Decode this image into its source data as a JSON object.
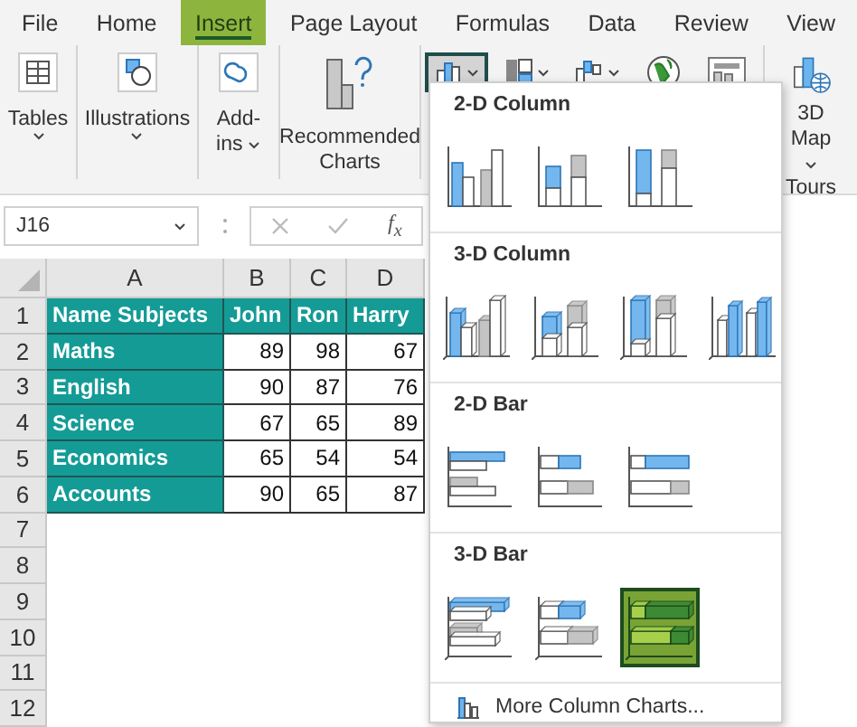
{
  "tabs": [
    {
      "label": "File",
      "selected": false
    },
    {
      "label": "Home",
      "selected": false
    },
    {
      "label": "Insert",
      "selected": true
    },
    {
      "label": "Page Layout",
      "selected": false
    },
    {
      "label": "Formulas",
      "selected": false
    },
    {
      "label": "Data",
      "selected": false
    },
    {
      "label": "Review",
      "selected": false
    },
    {
      "label": "View",
      "selected": false
    }
  ],
  "ribbon": {
    "groups": [
      {
        "kind": "tables",
        "label": "Tables",
        "dropdown": true
      },
      {
        "kind": "illustrations",
        "label": "Illustrations",
        "dropdown": true
      },
      {
        "kind": "addins",
        "label": "Add-ins",
        "dropdown": true
      },
      {
        "kind": "recommended",
        "label": "Recommended Charts",
        "dropdown": false
      },
      {
        "kind": "charts"
      },
      {
        "kind": "tours",
        "label": "3D Map",
        "dropdown": true,
        "group_label": "Tours"
      }
    ],
    "chart_buttons": [
      {
        "kind": "column",
        "selected": true,
        "dropdown": true
      },
      {
        "kind": "hierarchy",
        "selected": false,
        "dropdown": true
      },
      {
        "kind": "line",
        "selected": false,
        "dropdown": true
      },
      {
        "kind": "map",
        "selected": false,
        "dropdown": false
      },
      {
        "kind": "pivot",
        "selected": false,
        "dropdown": false
      }
    ]
  },
  "formula_bar": {
    "name_box": "J16",
    "function_label": "f$_{x}$"
  },
  "sheet": {
    "columns": [
      "A",
      "B",
      "C",
      "D"
    ],
    "rows": [
      {
        "number": "1",
        "cells": [
          {
            "text": "Name Subjects",
            "highlighted": true
          },
          {
            "text": "John",
            "highlighted": true
          },
          {
            "text": "Ron",
            "highlighted": true
          },
          {
            "text": "Harry",
            "highlighted": true
          }
        ]
      },
      {
        "number": "2",
        "cells": [
          {
            "text": "Maths",
            "highlighted": true
          },
          {
            "text": "89",
            "highlighted": false
          },
          {
            "text": "98",
            "highlighted": false
          },
          {
            "text": "67",
            "highlighted": false
          }
        ]
      },
      {
        "number": "3",
        "cells": [
          {
            "text": "English",
            "highlighted": true
          },
          {
            "text": "90",
            "highlighted": false
          },
          {
            "text": "87",
            "highlighted": false
          },
          {
            "text": "76",
            "highlighted": false
          }
        ]
      },
      {
        "number": "4",
        "cells": [
          {
            "text": "Science",
            "highlighted": true
          },
          {
            "text": "67",
            "highlighted": false
          },
          {
            "text": "65",
            "highlighted": false
          },
          {
            "text": "89",
            "highlighted": false
          }
        ]
      },
      {
        "number": "5",
        "cells": [
          {
            "text": "Economics",
            "highlighted": true
          },
          {
            "text": "65",
            "highlighted": false
          },
          {
            "text": "54",
            "highlighted": false
          },
          {
            "text": "54",
            "highlighted": false
          }
        ]
      },
      {
        "number": "6",
        "cells": [
          {
            "text": "Accounts",
            "highlighted": true
          },
          {
            "text": "90",
            "highlighted": false
          },
          {
            "text": "65",
            "highlighted": false
          },
          {
            "text": "87",
            "highlighted": false
          }
        ]
      },
      {
        "number": "7",
        "cells": []
      },
      {
        "number": "8",
        "cells": []
      },
      {
        "number": "9",
        "cells": []
      },
      {
        "number": "10",
        "cells": []
      },
      {
        "number": "11",
        "cells": []
      },
      {
        "number": "12",
        "cells": []
      }
    ]
  },
  "chart_menu": {
    "sections": [
      {
        "title": "2-D Column",
        "kind": "column",
        "options": [
          {
            "selected": false
          },
          {
            "selected": false
          },
          {
            "selected": false
          }
        ]
      },
      {
        "title": "3-D Column",
        "kind": "column3d",
        "options": [
          {
            "selected": false
          },
          {
            "selected": false
          },
          {
            "selected": false
          },
          {
            "selected": false
          }
        ]
      },
      {
        "title": "2-D Bar",
        "kind": "bar",
        "options": [
          {
            "selected": false
          },
          {
            "selected": false
          },
          {
            "selected": false
          }
        ]
      },
      {
        "title": "3-D Bar",
        "kind": "bar3d",
        "options": [
          {
            "selected": false
          },
          {
            "selected": false
          },
          {
            "selected": true
          }
        ]
      }
    ],
    "more_link": "More Column Charts..."
  }
}
